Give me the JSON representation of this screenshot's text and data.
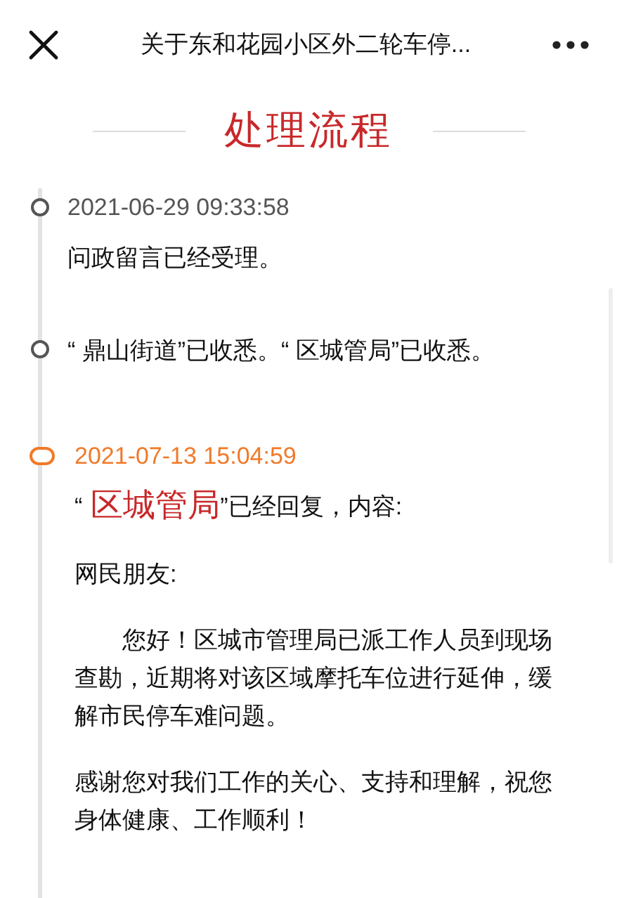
{
  "header": {
    "title": "关于东和花园小区外二轮车停..."
  },
  "section_title": "处理流程",
  "timeline": [
    {
      "highlighted": false,
      "time": "2021-06-29 09:33:58",
      "text": "问政留言已经受理。"
    },
    {
      "highlighted": false,
      "text": "“ 鼎山街道”已收悉。“ 区城管局”已收悉。"
    },
    {
      "highlighted": true,
      "time": "2021-07-13 15:04:59",
      "reply": {
        "quote_open": "“",
        "agency": "区城管局",
        "suffix": "”已经回复，内容:"
      },
      "paragraphs": [
        {
          "text": "网民朋友:",
          "indent": false
        },
        {
          "text": "您好！区城市管理局已派工作人员到现场查勘，近期将对该区域摩托车位进行延伸，缓解市民停车难问题。",
          "indent": true
        },
        {
          "text": "感谢您对我们工作的关心、支持和理解，祝您身体健康、工作顺利！",
          "indent": false
        }
      ]
    }
  ]
}
